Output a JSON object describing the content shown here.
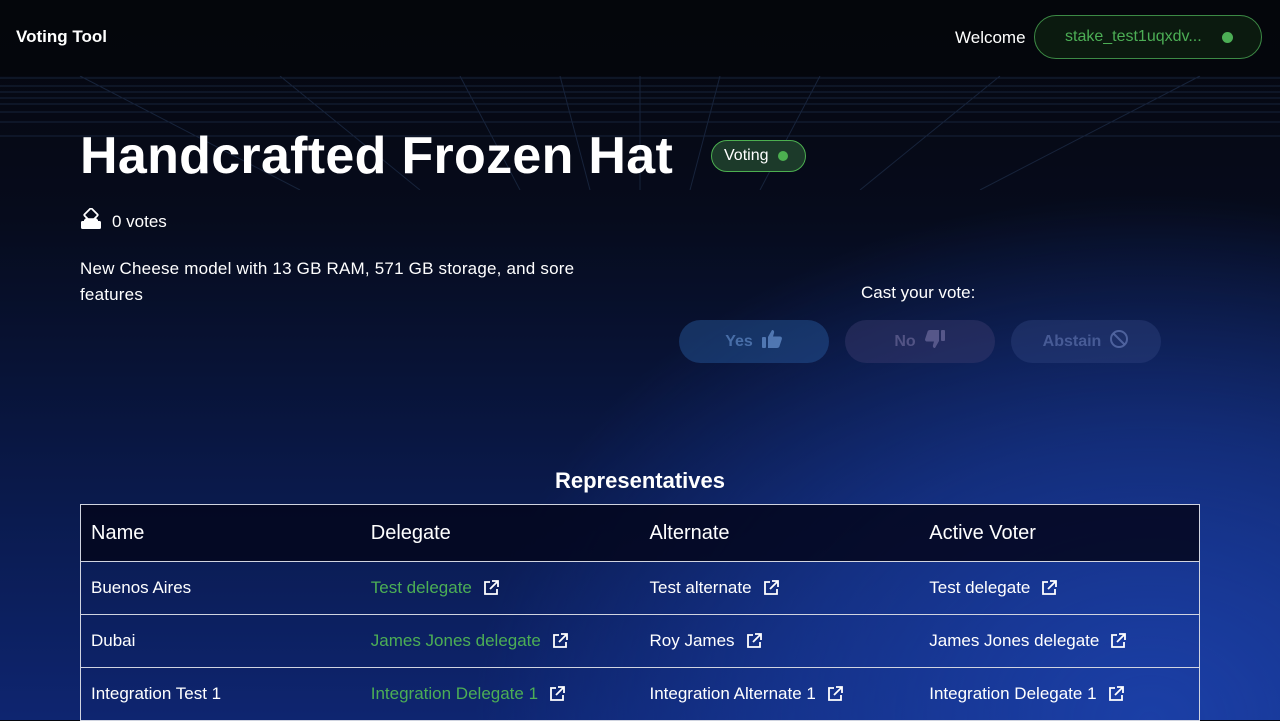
{
  "header": {
    "brand": "Voting Tool",
    "welcome": "Welcome",
    "wallet_address": "stake_test1uqxdv..."
  },
  "proposal": {
    "title": "Handcrafted Frozen Hat",
    "status": "Voting",
    "votes": "0 votes",
    "description": "New Cheese model with 13 GB RAM, 571 GB storage, and sore features"
  },
  "vote": {
    "cast_label": "Cast your vote:",
    "yes": "Yes",
    "no": "No",
    "abstain": "Abstain"
  },
  "representatives": {
    "title": "Representatives",
    "columns": [
      "Name",
      "Delegate",
      "Alternate",
      "Active Voter"
    ],
    "rows": [
      [
        "Buenos Aires",
        "Test delegate",
        "Test alternate",
        "Test delegate"
      ],
      [
        "Dubai",
        "James Jones delegate",
        "Roy James",
        "James Jones delegate"
      ],
      [
        "Integration Test 1",
        "Integration Delegate 1",
        "Integration Alternate 1",
        "Integration Delegate 1"
      ]
    ]
  },
  "colors": {
    "accent_green": "#4cae55",
    "background_dark": "#05070d",
    "background_blue": "#1b3fa6"
  },
  "icons": {
    "votes": "ballot-box-icon",
    "yes": "thumbs-up-icon",
    "no": "thumbs-down-icon",
    "abstain": "ban-icon",
    "link": "external-link-icon"
  }
}
